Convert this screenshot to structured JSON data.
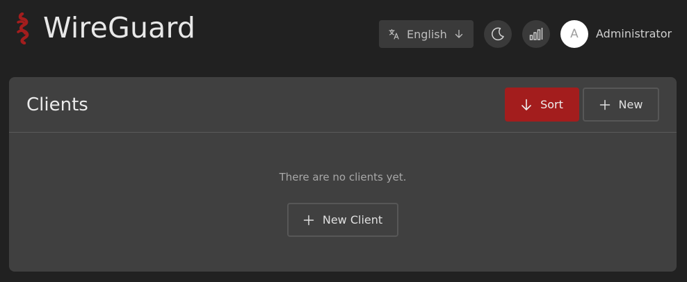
{
  "app": {
    "title": "WireGuard",
    "logo_icon": "wireguard-dragon-icon",
    "logo_color": "#a31d1d"
  },
  "header": {
    "language": {
      "selected": "English",
      "icon": "translate-icon",
      "arrow_icon": "arrow-down-icon"
    },
    "theme_toggle_icon": "moon-icon",
    "stats_icon": "signal-bars-icon",
    "user": {
      "avatar_initial": "A",
      "name": "Administrator"
    }
  },
  "clients": {
    "title": "Clients",
    "sort_label": "Sort",
    "new_label": "New",
    "empty_text": "There are no clients yet.",
    "new_client_label": "New Client"
  },
  "colors": {
    "background": "#212121",
    "panel": "#404040",
    "accent": "#a31d1d",
    "button_border": "#575757"
  }
}
